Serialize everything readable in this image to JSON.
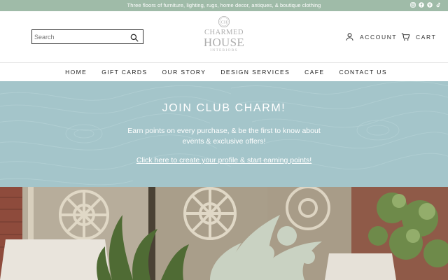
{
  "announcement": {
    "text": "Three floors of furniture, lighting, rugs, home decor, antiques, & boutique clothing",
    "social_icons": [
      "instagram-icon",
      "facebook-icon",
      "pinterest-icon",
      "tiktok-icon"
    ]
  },
  "header": {
    "search_placeholder": "Search",
    "logo": {
      "monogram": "CH",
      "line1": "CHARMED",
      "line2": "HOUSE",
      "line3": "INTERIORS"
    },
    "account_label": "ACCOUNT",
    "cart_label": "CART"
  },
  "nav": {
    "items": [
      "HOME",
      "GIFT CARDS",
      "OUR STORY",
      "DESIGN SERVICES",
      "CAFE",
      "CONTACT US"
    ]
  },
  "promo": {
    "title": "JOIN CLUB CHARM!",
    "body_line1": "Earn points on every purchase, & be the first to know about",
    "body_line2": "events & exclusive offers!",
    "link": "Click here to create your profile & start earning points!"
  },
  "colors": {
    "announcement_bg": "#9fbba8",
    "promo_bg": "#a4c5ca",
    "logo_gray": "#adadad"
  }
}
